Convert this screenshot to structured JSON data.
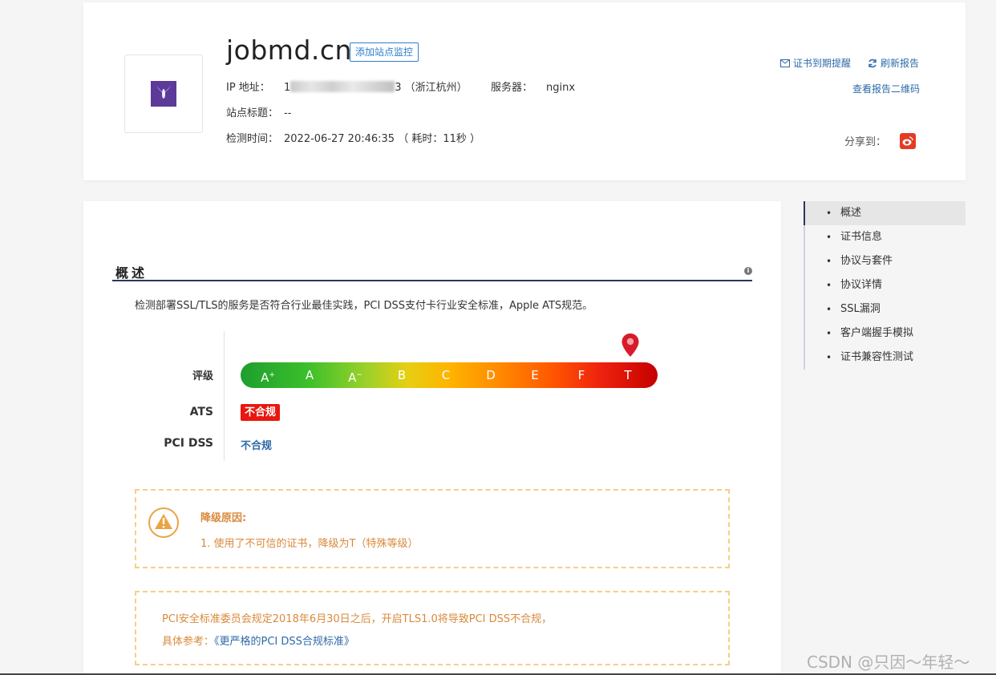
{
  "header": {
    "domain": "jobmd.cn",
    "add_monitor_label": "添加站点监控",
    "ip_label": "IP 地址：",
    "ip_visible_prefix": "1",
    "ip_visible_suffix": "3",
    "ip_location": "（浙江杭州）",
    "server_label": "服务器：",
    "server_value": "nginx",
    "site_title_label": "站点标题：",
    "site_title_value": "--",
    "check_time_label": "检测时间：",
    "check_time_value": "2022-06-27 20:46:35 （ 耗时：11秒 ）",
    "cert_alert_label": "证书到期提醒",
    "refresh_label": "刷新报告",
    "qr_label": "查看报告二维码",
    "share_label": "分享到："
  },
  "overview": {
    "title": "概述",
    "description": "检测部署SSL/TLS的服务是否符合行业最佳实践，PCI DSS支付卡行业安全标准，Apple ATS规范。",
    "grade_label": "评级",
    "grades": [
      {
        "base": "A",
        "sup": "+"
      },
      {
        "base": "A",
        "sup": ""
      },
      {
        "base": "A",
        "sup": "−"
      },
      {
        "base": "B",
        "sup": ""
      },
      {
        "base": "C",
        "sup": ""
      },
      {
        "base": "D",
        "sup": ""
      },
      {
        "base": "E",
        "sup": ""
      },
      {
        "base": "F",
        "sup": ""
      },
      {
        "base": "T",
        "sup": ""
      }
    ],
    "current_grade": "T",
    "ats_label": "ATS",
    "ats_value": "不合规",
    "pci_label": "PCI DSS",
    "pci_value": "不合规",
    "downgrade_title": "降级原因:",
    "downgrade_reason": "1. 使用了不可信的证书，降级为T（特殊等级）",
    "note_line1": "PCI安全标准委员会规定2018年6月30日之后，开启TLS1.0将导致PCI DSS不合规，",
    "note_ref_label": "具体参考：",
    "note_ref_link": "《更严格的PCI DSS合规标准》"
  },
  "sidenav": {
    "items": [
      "概述",
      "证书信息",
      "协议与套件",
      "协议详情",
      "SSL漏洞",
      "客户端握手模拟",
      "证书兼容性测试"
    ],
    "active_index": 0
  },
  "watermark": "CSDN @只因～年轻～",
  "colors": {
    "link": "#2e6aa8",
    "warning": "#d9893b",
    "danger": "#e8170f",
    "section_line": "#2c3563"
  }
}
